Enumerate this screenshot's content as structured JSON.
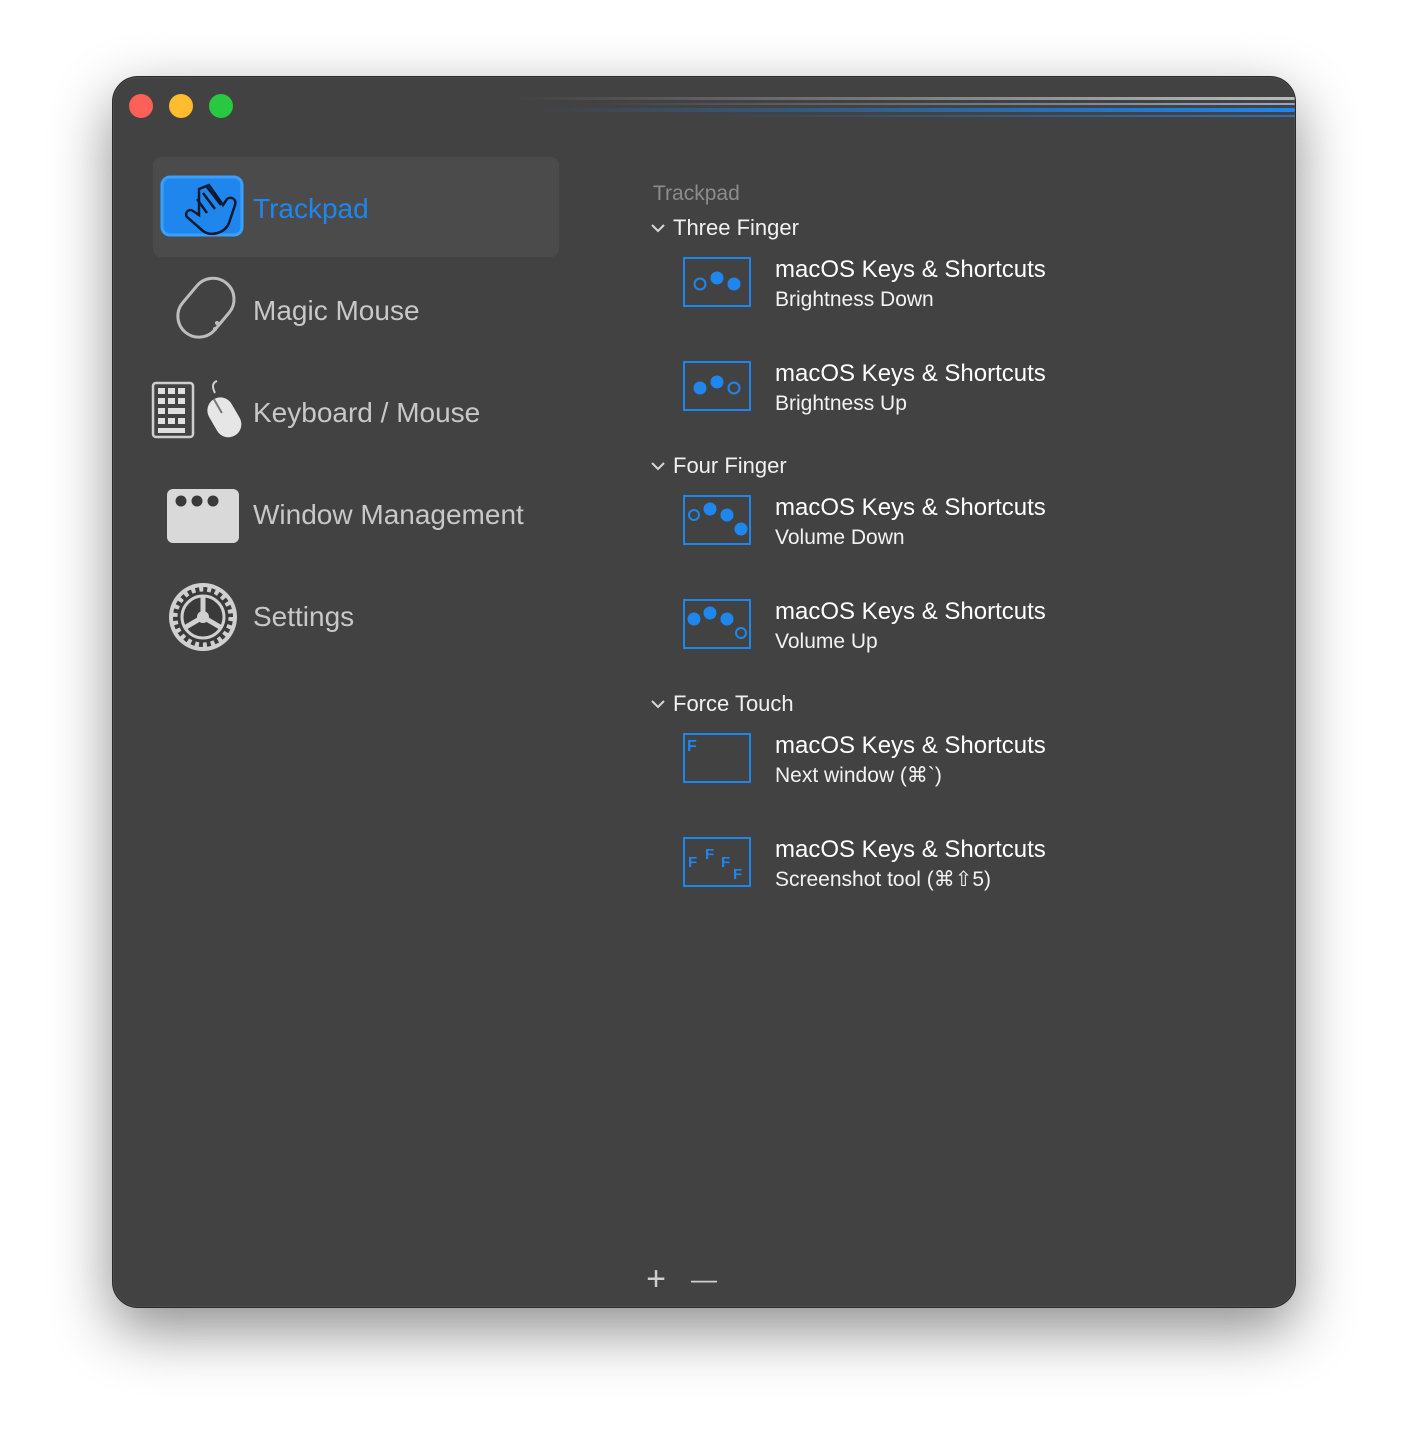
{
  "colors": {
    "accent": "#1f86ee",
    "window_bg": "#424242",
    "selected_bg": "#4b4b4b"
  },
  "sidebar": {
    "items": [
      {
        "label": "Trackpad",
        "icon": "trackpad-hand-icon",
        "selected": true
      },
      {
        "label": "Magic Mouse",
        "icon": "magic-mouse-icon",
        "selected": false
      },
      {
        "label": "Keyboard / Mouse",
        "icon": "keyboard-mouse-icon",
        "selected": false
      },
      {
        "label": "Window Management",
        "icon": "window-icon",
        "selected": false
      },
      {
        "label": "Settings",
        "icon": "gear-icon",
        "selected": false
      }
    ]
  },
  "panel": {
    "title": "Trackpad",
    "groups": [
      {
        "header": "Three Finger",
        "rows": [
          {
            "title": "macOS Keys & Shortcuts",
            "subtitle": "Brightness Down",
            "icon": "three-finger-left-open-icon"
          },
          {
            "title": "macOS Keys & Shortcuts",
            "subtitle": "Brightness Up",
            "icon": "three-finger-right-open-icon"
          }
        ]
      },
      {
        "header": "Four Finger",
        "rows": [
          {
            "title": "macOS Keys & Shortcuts",
            "subtitle": "Volume Down",
            "icon": "four-finger-left-open-icon"
          },
          {
            "title": "macOS Keys & Shortcuts",
            "subtitle": "Volume Up",
            "icon": "four-finger-right-open-icon"
          }
        ]
      },
      {
        "header": "Force Touch",
        "rows": [
          {
            "title": "macOS Keys & Shortcuts",
            "subtitle": "Next window (⌘`)",
            "icon": "force-touch-single-icon",
            "icon_text": "F"
          },
          {
            "title": "macOS Keys & Shortcuts",
            "subtitle": "Screenshot tool (⌘⇧5)",
            "icon": "force-touch-multi-icon",
            "icon_text": "F"
          }
        ]
      }
    ]
  },
  "bottom": {
    "add": "+",
    "remove": "—"
  }
}
